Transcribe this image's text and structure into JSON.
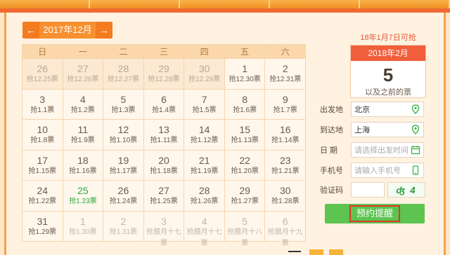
{
  "calendar": {
    "month_label": "2017年12月",
    "prev_icon": "arrow-left-icon",
    "next_icon": "arrow-right-icon",
    "weekdays": [
      "日",
      "一",
      "二",
      "三",
      "四",
      "五",
      "六"
    ],
    "weeks": [
      [
        {
          "day": "26",
          "note": "抢12.25票",
          "state": "past"
        },
        {
          "day": "27",
          "note": "抢12.26票",
          "state": "past"
        },
        {
          "day": "28",
          "note": "抢12.27票",
          "state": "past"
        },
        {
          "day": "29",
          "note": "抢12.28票",
          "state": "past"
        },
        {
          "day": "30",
          "note": "抢12.29票",
          "state": "past"
        },
        {
          "day": "1",
          "note": "抢12.30票",
          "state": "normal"
        },
        {
          "day": "2",
          "note": "抢12.31票",
          "state": "normal"
        }
      ],
      [
        {
          "day": "3",
          "note": "抢1.1票",
          "state": "normal"
        },
        {
          "day": "4",
          "note": "抢1.2票",
          "state": "normal"
        },
        {
          "day": "5",
          "note": "抢1.3票",
          "state": "normal"
        },
        {
          "day": "6",
          "note": "抢1.4票",
          "state": "normal"
        },
        {
          "day": "7",
          "note": "抢1.5票",
          "state": "normal"
        },
        {
          "day": "8",
          "note": "抢1.6票",
          "state": "normal"
        },
        {
          "day": "9",
          "note": "抢1.7票",
          "state": "normal"
        }
      ],
      [
        {
          "day": "10",
          "note": "抢1.8票",
          "state": "normal"
        },
        {
          "day": "11",
          "note": "抢1.9票",
          "state": "normal"
        },
        {
          "day": "12",
          "note": "抢1.10票",
          "state": "normal"
        },
        {
          "day": "13",
          "note": "抢1.11票",
          "state": "normal"
        },
        {
          "day": "14",
          "note": "抢1.12票",
          "state": "normal"
        },
        {
          "day": "15",
          "note": "抢1.13票",
          "state": "normal"
        },
        {
          "day": "16",
          "note": "抢1.14票",
          "state": "normal"
        }
      ],
      [
        {
          "day": "17",
          "note": "抢1.15票",
          "state": "normal"
        },
        {
          "day": "18",
          "note": "抢1.16票",
          "state": "normal"
        },
        {
          "day": "19",
          "note": "抢1.17票",
          "state": "normal"
        },
        {
          "day": "20",
          "note": "抢1.18票",
          "state": "normal"
        },
        {
          "day": "21",
          "note": "抢1.19票",
          "state": "normal"
        },
        {
          "day": "22",
          "note": "抢1.20票",
          "state": "normal"
        },
        {
          "day": "23",
          "note": "抢1.21票",
          "state": "normal"
        }
      ],
      [
        {
          "day": "24",
          "note": "抢1.22票",
          "state": "normal"
        },
        {
          "day": "25",
          "note": "抢1.23票",
          "state": "today"
        },
        {
          "day": "26",
          "note": "抢1.24票",
          "state": "normal"
        },
        {
          "day": "27",
          "note": "抢1.25票",
          "state": "normal"
        },
        {
          "day": "28",
          "note": "抢1.26票",
          "state": "normal"
        },
        {
          "day": "29",
          "note": "抢1.27票",
          "state": "normal"
        },
        {
          "day": "30",
          "note": "抢1.28票",
          "state": "normal"
        }
      ],
      [
        {
          "day": "31",
          "note": "抢1.29票",
          "state": "normal"
        },
        {
          "day": "1",
          "note": "抢1.30票",
          "state": "next"
        },
        {
          "day": "2",
          "note": "抢1.31票",
          "state": "next"
        },
        {
          "day": "3",
          "note": "抢腊月十七票",
          "state": "next"
        },
        {
          "day": "4",
          "note": "抢腊月十七票",
          "state": "next"
        },
        {
          "day": "5",
          "note": "抢腊月十八票",
          "state": "next"
        },
        {
          "day": "6",
          "note": "抢腊月十九票",
          "state": "next"
        }
      ]
    ]
  },
  "panel": {
    "notice": "18年1月7日可抢",
    "card_title": "2018年2月",
    "card_number": "5",
    "card_subtitle": "以及之前的票",
    "from_label": "出发地",
    "from_value": "北京",
    "to_label": "到达地",
    "to_value": "上海",
    "date_label": "日 期",
    "date_placeholder": "请选择出发时间",
    "phone_label": "手机号",
    "phone_placeholder": "请输入手机号",
    "captcha_label": "验证码",
    "captcha_text": "ʤ 4",
    "submit_label": "预约提醒"
  },
  "colors": {
    "accent_orange": "#f47b1f",
    "card_red": "#f05e3b",
    "submit_green": "#5cc44f",
    "today_green": "#2ea843"
  }
}
